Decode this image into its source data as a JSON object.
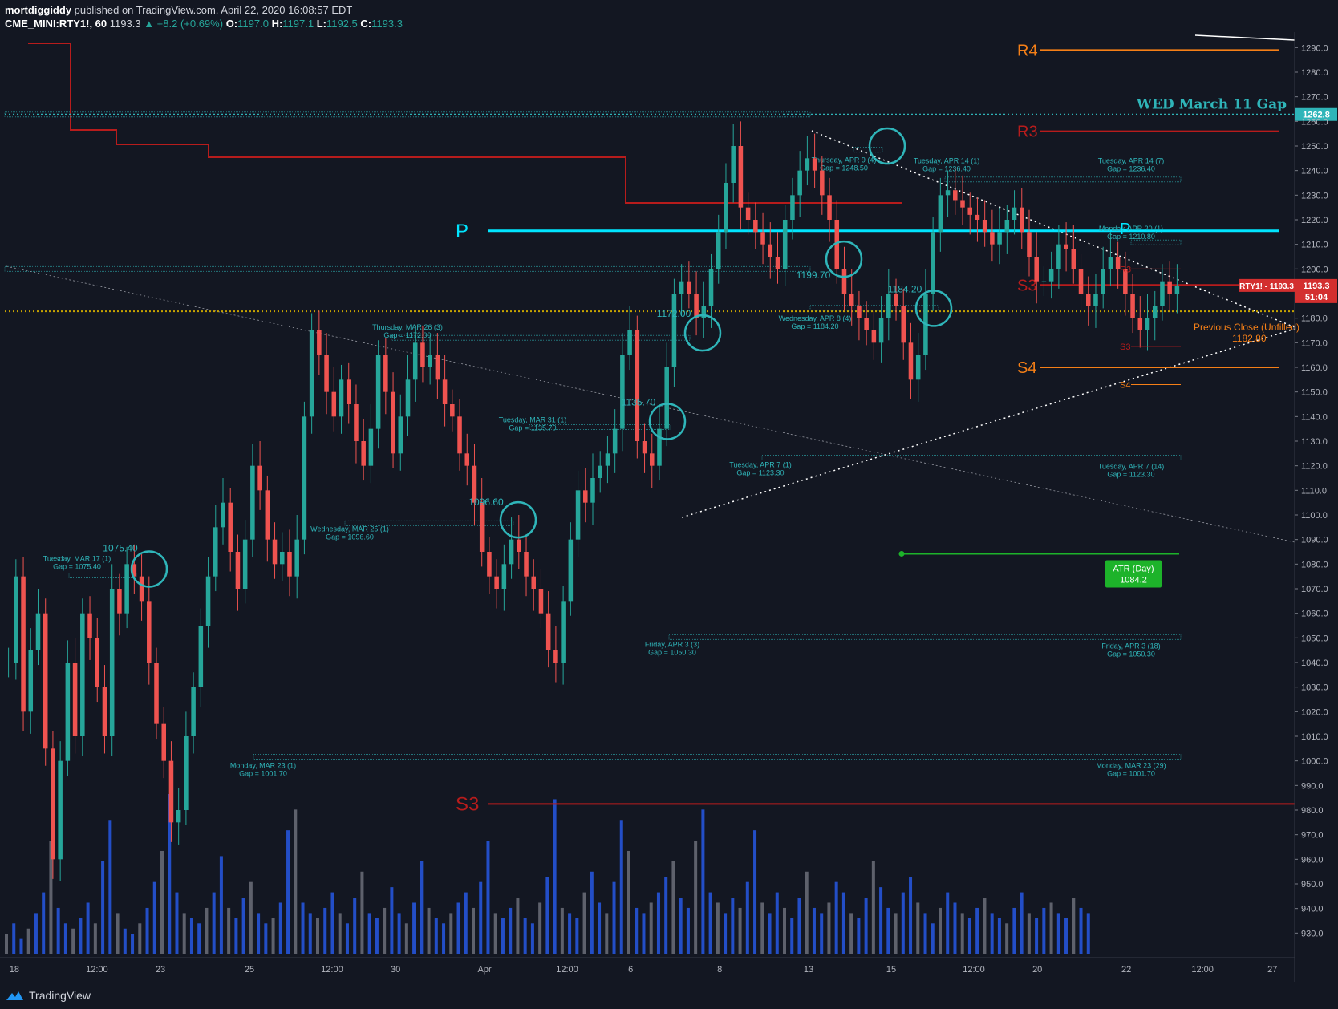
{
  "header": {
    "author": "mortdiggiddy",
    "published": "published on TradingView.com, April 22, 2020 16:08:57 EDT",
    "symbol": "CME_MINI:RTY1!, 60",
    "last": "1193.3",
    "change": "▲ +8.2 (+0.69%)",
    "o_label": "O:",
    "o": "1197.0",
    "h_label": "H:",
    "h": "1197.1",
    "l_label": "L:",
    "l": "1192.5",
    "c_label": "C:",
    "c": "1193.3"
  },
  "footer": {
    "brand": "TradingView"
  },
  "colors": {
    "background": "#131722",
    "up": "#26a69a",
    "down": "#ef5350",
    "cyan": "#26c6da",
    "teal_label": "#2fb5b9",
    "pivot_orange": "#f57f17",
    "pivot_red": "#b71c1c",
    "atr_green": "#1db32a",
    "volume_blue": "#2962ff",
    "volume_gray": "#787b86"
  },
  "chart_data": {
    "type": "candlestick",
    "ylim": [
      920,
      1295
    ],
    "y_ticks": [
      "930.0",
      "940.0",
      "950.0",
      "960.0",
      "970.0",
      "980.0",
      "990.0",
      "1000.0",
      "1010.0",
      "1020.0",
      "1030.0",
      "1040.0",
      "1050.0",
      "1060.0",
      "1070.0",
      "1080.0",
      "1090.0",
      "1100.0",
      "1110.0",
      "1120.0",
      "1130.0",
      "1140.0",
      "1150.0",
      "1160.0",
      "1170.0",
      "1180.0",
      "1190.0",
      "1200.0",
      "1210.0",
      "1220.0",
      "1230.0",
      "1240.0",
      "1250.0",
      "1260.0",
      "1270.0",
      "1280.0",
      "1290.0"
    ],
    "x_ticks": [
      {
        "label": "18",
        "i": 1
      },
      {
        "label": "12:00",
        "i": 14
      },
      {
        "label": "23",
        "i": 24
      },
      {
        "label": "25",
        "i": 38
      },
      {
        "label": "12:00",
        "i": 51
      },
      {
        "label": "30",
        "i": 61
      },
      {
        "label": "Apr",
        "i": 75
      },
      {
        "label": "12:00",
        "i": 88
      },
      {
        "label": "6",
        "i": 98
      },
      {
        "label": "8",
        "i": 112
      },
      {
        "label": "13",
        "i": 126
      },
      {
        "label": "15",
        "i": 139
      },
      {
        "label": "12:00",
        "i": 152
      },
      {
        "label": "20",
        "i": 162
      },
      {
        "label": "22",
        "i": 176
      },
      {
        "label": "12:00",
        "i": 188
      },
      {
        "label": "27",
        "i": 199
      }
    ],
    "n_slots": 203,
    "closes": [
      1040,
      1075,
      1020,
      1045,
      1060,
      1005,
      960,
      1000,
      1040,
      1010,
      1060,
      1050,
      1030,
      1010,
      1070,
      1060,
      1080,
      1075,
      1065,
      1040,
      1015,
      1000,
      975,
      980,
      1010,
      1030,
      1055,
      1075,
      1095,
      1105,
      1085,
      1070,
      1090,
      1120,
      1110,
      1090,
      1080,
      1085,
      1075,
      1090,
      1140,
      1175,
      1165,
      1150,
      1140,
      1155,
      1145,
      1130,
      1120,
      1135,
      1165,
      1150,
      1125,
      1140,
      1155,
      1170,
      1160,
      1165,
      1155,
      1145,
      1140,
      1125,
      1120,
      1105,
      1085,
      1075,
      1070,
      1080,
      1090,
      1085,
      1075,
      1070,
      1060,
      1045,
      1040,
      1065,
      1090,
      1110,
      1105,
      1115,
      1120,
      1125,
      1135,
      1165,
      1175,
      1130,
      1125,
      1120,
      1135,
      1160,
      1190,
      1195,
      1190,
      1180,
      1185,
      1200,
      1215,
      1235,
      1250,
      1225,
      1220,
      1215,
      1210,
      1205,
      1200,
      1220,
      1230,
      1240,
      1245,
      1240,
      1230,
      1220,
      1200,
      1190,
      1185,
      1180,
      1175,
      1170,
      1180,
      1190,
      1185,
      1170,
      1155,
      1165,
      1190,
      1215,
      1230,
      1232,
      1228,
      1225,
      1222,
      1220,
      1215,
      1210,
      1215,
      1220,
      1225,
      1215,
      1205,
      1195,
      1195,
      1200,
      1210,
      1208,
      1200,
      1190,
      1185,
      1190,
      1200,
      1205,
      1200,
      1190,
      1180,
      1175,
      1180,
      1185,
      1195,
      1190,
      1193
    ],
    "series": [
      {
        "name": "RTY1!",
        "last": "1193.3",
        "countdown": "51:04"
      }
    ],
    "volume": [
      4,
      6,
      3,
      5,
      8,
      12,
      22,
      9,
      6,
      5,
      7,
      10,
      6,
      18,
      26,
      8,
      5,
      4,
      6,
      9,
      14,
      20,
      31,
      12,
      8,
      7,
      6,
      9,
      12,
      19,
      9,
      7,
      11,
      14,
      8,
      6,
      7,
      10,
      24,
      28,
      10,
      8,
      7,
      9,
      12,
      8,
      6,
      11,
      16,
      8,
      7,
      9,
      13,
      8,
      6,
      10,
      18,
      9,
      7,
      6,
      8,
      10,
      12,
      9,
      14,
      22,
      8,
      7,
      9,
      11,
      7,
      6,
      10,
      15,
      30,
      9,
      8,
      7,
      12,
      16,
      10,
      8,
      14,
      26,
      20,
      9,
      8,
      10,
      12,
      15,
      18,
      11,
      9,
      22,
      28,
      12,
      10,
      8,
      11,
      9,
      14,
      24,
      10,
      8,
      12,
      9,
      7,
      11,
      16,
      9,
      8,
      10,
      14,
      12,
      8,
      7,
      11,
      18,
      13,
      9,
      8,
      12,
      15,
      10,
      8,
      6,
      9,
      12,
      10,
      8,
      7,
      9,
      11,
      8,
      7,
      6,
      9,
      12,
      8,
      7,
      9,
      10,
      8,
      7,
      11,
      9,
      8
    ],
    "levels": [
      {
        "label": "R4",
        "value": 1289
      },
      {
        "label": "WED March 11 Gap",
        "value": 1262.8,
        "tag": "1262.8"
      },
      {
        "label": "R3",
        "value": 1256
      },
      {
        "label": "P",
        "value": 1215.5
      },
      {
        "label": "S3",
        "value": 1193.5
      },
      {
        "label": "S4",
        "value": 1160
      },
      {
        "label": "S3",
        "value": 982.5
      },
      {
        "label": "Previous Close (Unfilled)",
        "value": 1182.8,
        "tag": "1182.80"
      }
    ],
    "gap_labels": [
      {
        "text1": "Tuesday, MAR 17 (1)",
        "text2": "Gap = 1075.40",
        "value": 1075.4
      },
      {
        "text1": "Thursday, MAR 26 (3)",
        "text2": "Gap = 1172.00",
        "value": 1172.0
      },
      {
        "text1": "Wednesday, MAR 25 (1)",
        "text2": "Gap = 1096.60",
        "value": 1096.6
      },
      {
        "text1": "Tuesday, MAR 31 (1)",
        "text2": "Gap = 1135.70",
        "value": 1135.7
      },
      {
        "text1": "Monday, MAR 23 (1)",
        "text2": "Gap = 1001.70",
        "value": 1001.7
      },
      {
        "text1": "Friday, APR 3 (3)",
        "text2": "Gap = 1050.30",
        "value": 1050.3
      },
      {
        "text1": "Tuesday, APR 7 (1)",
        "text2": "Gap = 1123.30",
        "value": 1123.3
      },
      {
        "text1": "Wednesday, APR 8 (4)",
        "text2": "Gap = 1184.20",
        "value": 1184.2
      },
      {
        "text1": "Thursday, APR 9 (4)",
        "text2": "Gap = 1248.50",
        "value": 1248.5
      },
      {
        "text1": "Tuesday, APR 14 (1)",
        "text2": "Gap = 1236.40",
        "value": 1236.4
      },
      {
        "text1": "Tuesday, APR 14 (7)",
        "text2": "Gap = 1236.40",
        "value": 1236.4
      },
      {
        "text1": "Monday, APR 20 (1)",
        "text2": "Gap = 1210.80",
        "value": 1210.8
      },
      {
        "text1": "Tuesday, APR 7 (14)",
        "text2": "Gap = 1123.30",
        "value": 1123.3
      },
      {
        "text1": "Friday, APR 3 (18)",
        "text2": "Gap = 1050.30",
        "value": 1050.3
      },
      {
        "text1": "Monday, MAR 23 (29)",
        "text2": "Gap = 1001.70",
        "value": 1001.7
      }
    ],
    "circle_labels": [
      "1075.40",
      "1096.60",
      "1135.70",
      "1172.00",
      "1199.70",
      "1184.20"
    ],
    "atr": {
      "label": "ATR (Day)",
      "value": "1084.2"
    },
    "small_pivots": [
      "R3",
      "P",
      "S3",
      "S4"
    ]
  }
}
